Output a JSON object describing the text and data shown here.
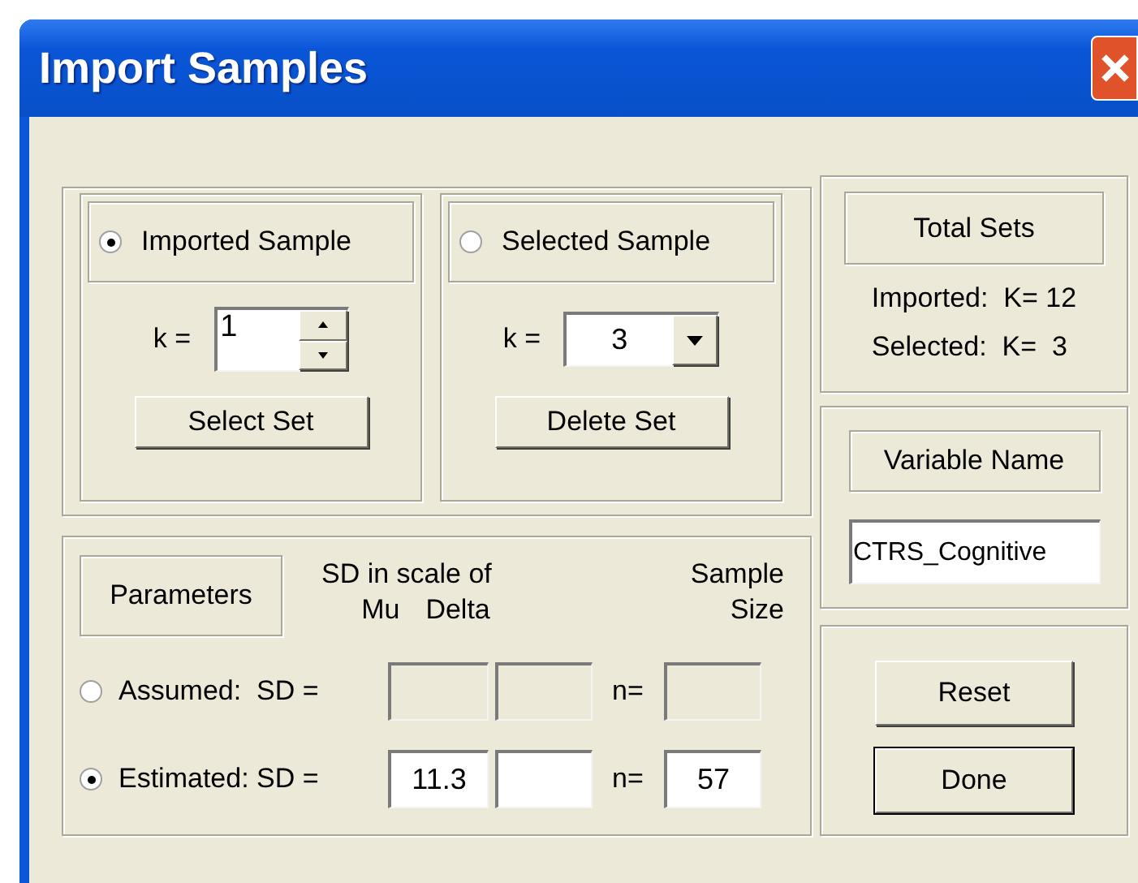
{
  "window": {
    "title": "Import Samples"
  },
  "samples": [
    {
      "label": "Imported Sample",
      "selected": true,
      "k_label": "k =",
      "k_value": "1",
      "kind": "spinner",
      "button": "Select Set"
    },
    {
      "label": "Selected Sample",
      "selected": false,
      "k_label": "k =",
      "k_value": "3",
      "kind": "dropdown",
      "button": "Delete Set"
    }
  ],
  "parameters": {
    "label": "Parameters",
    "header_sd": "SD in scale of",
    "header_sample": "Sample",
    "col_mu": "Mu",
    "col_delta": "Delta",
    "col_size": "Size",
    "rows": [
      {
        "label": "Assumed:  SD =",
        "selected": false,
        "disabled": true,
        "n_label": "n="
      },
      {
        "label": "Estimated: SD =",
        "selected": true,
        "disabled": false,
        "mu": "11.3",
        "n_label": "n=",
        "n": "57"
      }
    ]
  },
  "total_sets": {
    "title": "Total Sets",
    "lines": [
      "Imported:  K= 12",
      "Selected:  K=  3"
    ]
  },
  "variable": {
    "title": "Variable Name",
    "value": "CTRS_Cognitive"
  },
  "buttons": [
    {
      "label": "Reset",
      "default": false
    },
    {
      "label": "Done",
      "default": true
    }
  ]
}
